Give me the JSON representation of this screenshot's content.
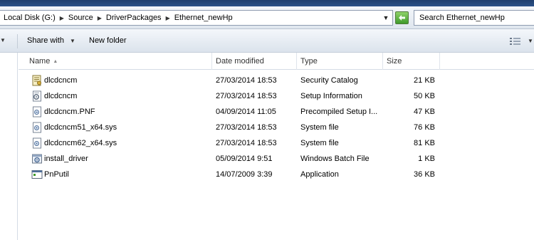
{
  "address": {
    "crumbs": [
      "Local Disk (G:)",
      "Source",
      "DriverPackages",
      "Ethernet_newHp"
    ]
  },
  "search": {
    "value": "Search Ethernet_newHp"
  },
  "toolbar": {
    "share_label": "Share with",
    "newfolder_label": "New folder"
  },
  "columns": {
    "name": "Name",
    "date": "Date modified",
    "type": "Type",
    "size": "Size"
  },
  "files": [
    {
      "name": "dlcdcncm",
      "date": "27/03/2014 18:53",
      "type": "Security Catalog",
      "size": "21 KB",
      "icon": "security-catalog-icon"
    },
    {
      "name": "dlcdcncm",
      "date": "27/03/2014 18:53",
      "type": "Setup Information",
      "size": "50 KB",
      "icon": "setup-information-icon"
    },
    {
      "name": "dlcdcncm.PNF",
      "date": "04/09/2014 11:05",
      "type": "Precompiled Setup I...",
      "size": "47 KB",
      "icon": "generic-file-icon"
    },
    {
      "name": "dlcdcncm51_x64.sys",
      "date": "27/03/2014 18:53",
      "type": "System file",
      "size": "76 KB",
      "icon": "system-file-icon"
    },
    {
      "name": "dlcdcncm62_x64.sys",
      "date": "27/03/2014 18:53",
      "type": "System file",
      "size": "81 KB",
      "icon": "system-file-icon"
    },
    {
      "name": "install_driver",
      "date": "05/09/2014 9:51",
      "type": "Windows Batch File",
      "size": "1 KB",
      "icon": "batch-file-icon"
    },
    {
      "name": "PnPutil",
      "date": "14/07/2009 3:39",
      "type": "Application",
      "size": "36 KB",
      "icon": "application-icon"
    }
  ],
  "colors": {
    "titlebar": "#2b5188",
    "refresh": "#3e9a2a",
    "separator": "#d5dce5"
  }
}
